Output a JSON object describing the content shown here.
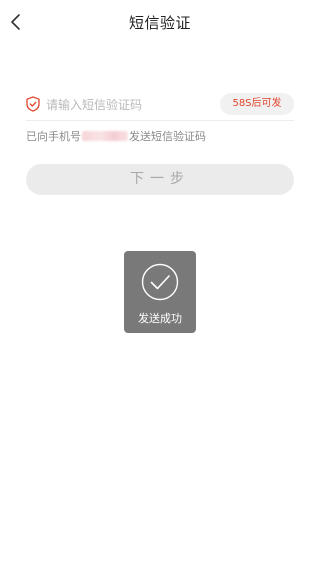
{
  "header": {
    "title": "短信验证",
    "back_icon": "chevron-left-icon"
  },
  "verification": {
    "placeholder": "请输入短信验证码",
    "value": "",
    "shield_icon": "shield-icon",
    "resend_label": "58S后可发"
  },
  "sent_message": {
    "prefix": "已向手机号",
    "suffix": "发送短信验证码"
  },
  "next_button": {
    "label": "下一步"
  },
  "toast": {
    "icon": "check-circle-icon",
    "text": "发送成功"
  },
  "colors": {
    "accent": "#e0472e",
    "button_bg": "#ebebeb",
    "toast_bg": "#6e6e6e"
  }
}
